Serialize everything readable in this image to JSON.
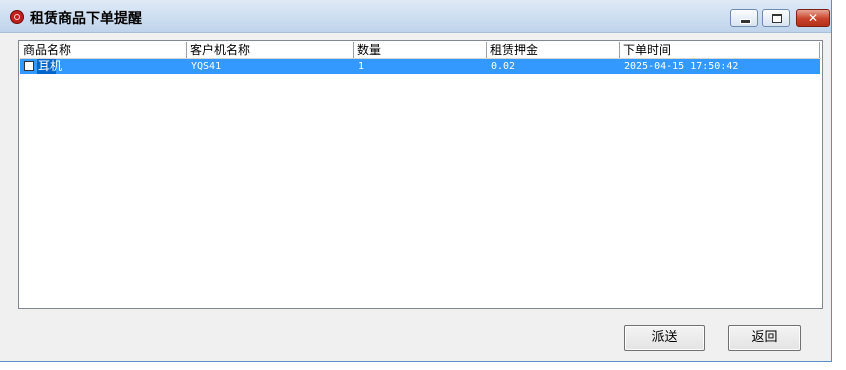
{
  "window": {
    "title": "租赁商品下单提醒",
    "controls": {
      "minimize_icon": "minimize-icon",
      "maximize_icon": "maximize-icon",
      "close_glyph": "✕"
    }
  },
  "table": {
    "columns": [
      "商品名称",
      "客户机名称",
      "数量",
      "租赁押金",
      "下单时间"
    ],
    "rows": [
      {
        "checked": false,
        "selected": true,
        "product": "耳机",
        "client": "YQS41",
        "quantity": "1",
        "deposit": "0.02",
        "order_time": "2025-04-15 17:50:42"
      }
    ]
  },
  "buttons": {
    "dispatch": "派送",
    "back": "返回"
  },
  "colors": {
    "selection": "#3399ff",
    "titlebar": "#cfdff1",
    "close_button": "#c7432b"
  }
}
